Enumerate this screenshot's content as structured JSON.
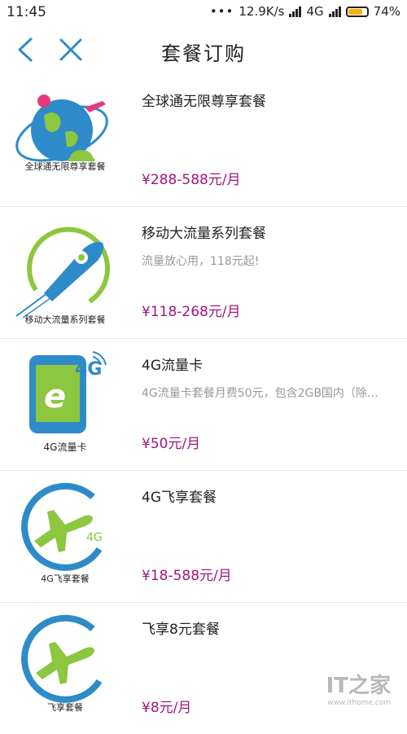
{
  "status_bar": {
    "time": "11:45",
    "network_speed": "12.9K/s",
    "network_type": "4G",
    "battery": "74%"
  },
  "nav": {
    "title": "套餐订购",
    "back_icon": "chevron-left-icon",
    "close_icon": "close-icon"
  },
  "colors": {
    "accent": "#2e8bc9",
    "price": "#a0167c",
    "green": "#8dc63f"
  },
  "items": [
    {
      "title": "全球通无限尊享套餐",
      "desc": "",
      "price": "¥288-588元/月",
      "caption": "全球通无限尊享套餐",
      "icon": "globe-travel-icon"
    },
    {
      "title": "移动大流量系列套餐",
      "desc": "流量放心用，118元起!",
      "price": "¥118-268元/月",
      "caption": "移动大流量系列套餐",
      "icon": "rocket-icon"
    },
    {
      "title": "4G流量卡",
      "desc": "4G流量卡套餐月费50元，包含2GB国内（除…",
      "price": "¥50元/月",
      "caption": "4G流量卡",
      "icon": "phone-4g-icon"
    },
    {
      "title": "4G飞享套餐",
      "desc": "",
      "price": "¥18-588元/月",
      "caption": "4G飞享套餐",
      "icon": "airplane-4g-icon"
    },
    {
      "title": "飞享8元套餐",
      "desc": "",
      "price": "¥8元/月",
      "caption": "飞享套餐",
      "icon": "airplane-icon"
    }
  ],
  "watermark": {
    "text": "IT之家",
    "url": "www.ithome.com"
  }
}
